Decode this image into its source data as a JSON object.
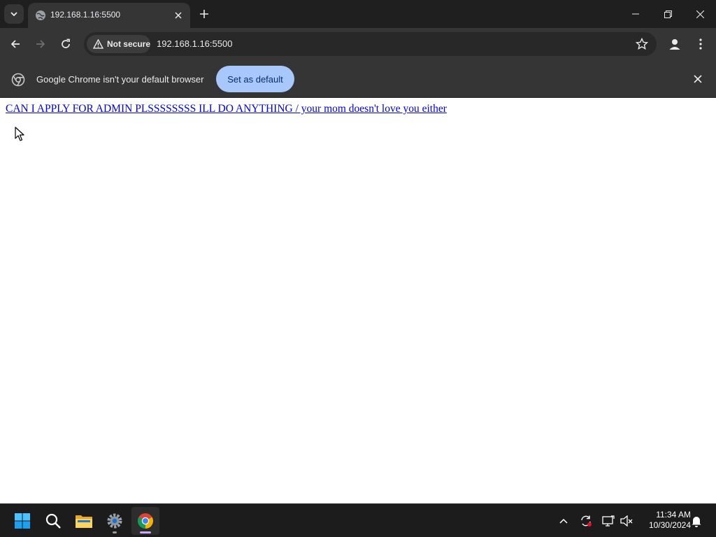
{
  "browser": {
    "tab": {
      "title": "192.168.1.16:5500"
    },
    "address": {
      "security_label": "Not secure",
      "url": "192.168.1.16:5500"
    },
    "infobar": {
      "message": "Google Chrome isn't your default browser",
      "button_label": "Set as default"
    }
  },
  "page": {
    "link_text": "CAN I APPLY FOR ADMIN PLSSSSSSSS ILL DO ANYTHING / your mom doesn't love you either"
  },
  "taskbar": {
    "apps": [
      "start-icon",
      "search-icon",
      "file-explorer-icon",
      "settings-icon",
      "chrome-icon"
    ],
    "time": "11:34 AM",
    "date": "10/30/2024"
  },
  "colors": {
    "tabstrip": "#1f1f1f",
    "toolbar": "#353535",
    "omnibox": "#282828",
    "button_accent": "#a8c7fa",
    "link": "#0000ee",
    "taskbar": "#1c1c1c"
  }
}
